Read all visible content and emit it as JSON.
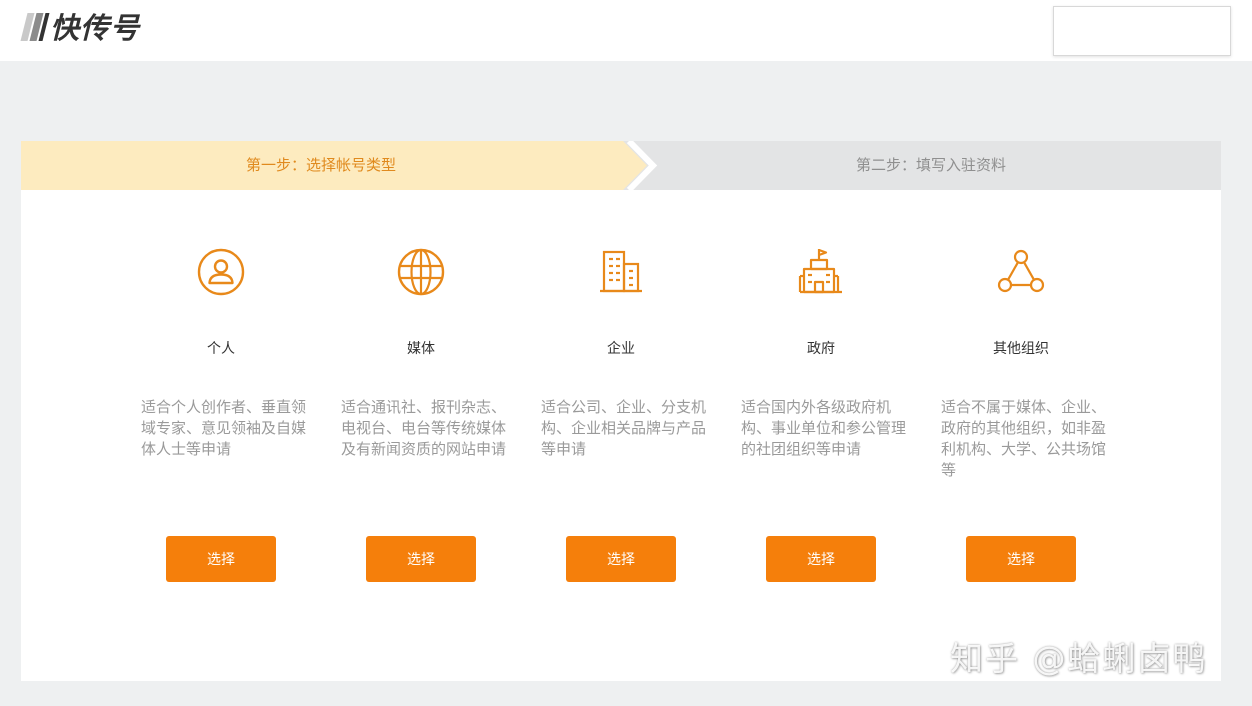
{
  "header": {
    "logo_text": "快传号"
  },
  "steps": {
    "step1_label": "第一步：选择帐号类型",
    "step2_label": "第二步：填写入驻资料"
  },
  "cards": [
    {
      "icon": "user-icon",
      "title": "个人",
      "description": "适合个人创作者、垂直领域专家、意见领袖及自媒体人士等申请",
      "button_label": "选择"
    },
    {
      "icon": "globe-icon",
      "title": "媒体",
      "description": "适合通讯社、报刊杂志、电视台、电台等传统媒体及有新闻资质的网站申请",
      "button_label": "选择"
    },
    {
      "icon": "building-icon",
      "title": "企业",
      "description": "适合公司、企业、分支机构、企业相关品牌与产品等申请",
      "button_label": "选择"
    },
    {
      "icon": "government-building-icon",
      "title": "政府",
      "description": "适合国内外各级政府机构、事业单位和参公管理的社团组织等申请",
      "button_label": "选择"
    },
    {
      "icon": "organization-icon",
      "title": "其他组织",
      "description": "适合不属于媒体、企业、政府的其他组织，如非盈利机构、大学、公共场馆等",
      "button_label": "选择"
    }
  ],
  "watermark": "知乎 @蛤蜊卤鸭",
  "colors": {
    "accent": "#f57f0b",
    "step_active_bg": "#fdebbf",
    "step_active_text": "#e08a1e",
    "step_inactive_bg": "#e3e4e5",
    "page_bg": "#eef0f1"
  }
}
